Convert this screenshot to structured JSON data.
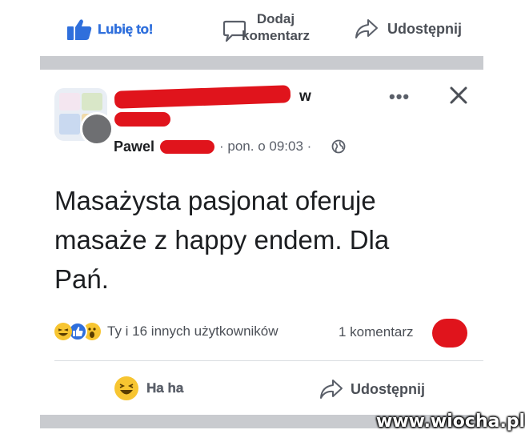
{
  "top_actions": {
    "like_label": "Lubię to!",
    "comment_label_line1": "Dodaj",
    "comment_label_line2": "komentarz",
    "share_label": "Udostępnij"
  },
  "post": {
    "group_suffix": "w",
    "author_first_name": "Pawel",
    "timestamp": "· pon. o 09:03 ·",
    "body_line1": "Masażysta pasjonat oferuje",
    "body_line2": "masaże z happy endem. Dla",
    "body_line3": "Pań.",
    "reactions_text": "Ty i 16 innych użytkowników",
    "comments_count": "1 komentarz"
  },
  "bottom_actions": {
    "haha_label": "Ha ha",
    "share_label": "Udostępnij"
  },
  "watermark": "www.wiocha.pl",
  "colors": {
    "like_blue": "#2f6fdc",
    "redaction_red": "#e0141c",
    "divider_gray": "#c9cbcf",
    "haha_yellow": "#f7c531"
  }
}
